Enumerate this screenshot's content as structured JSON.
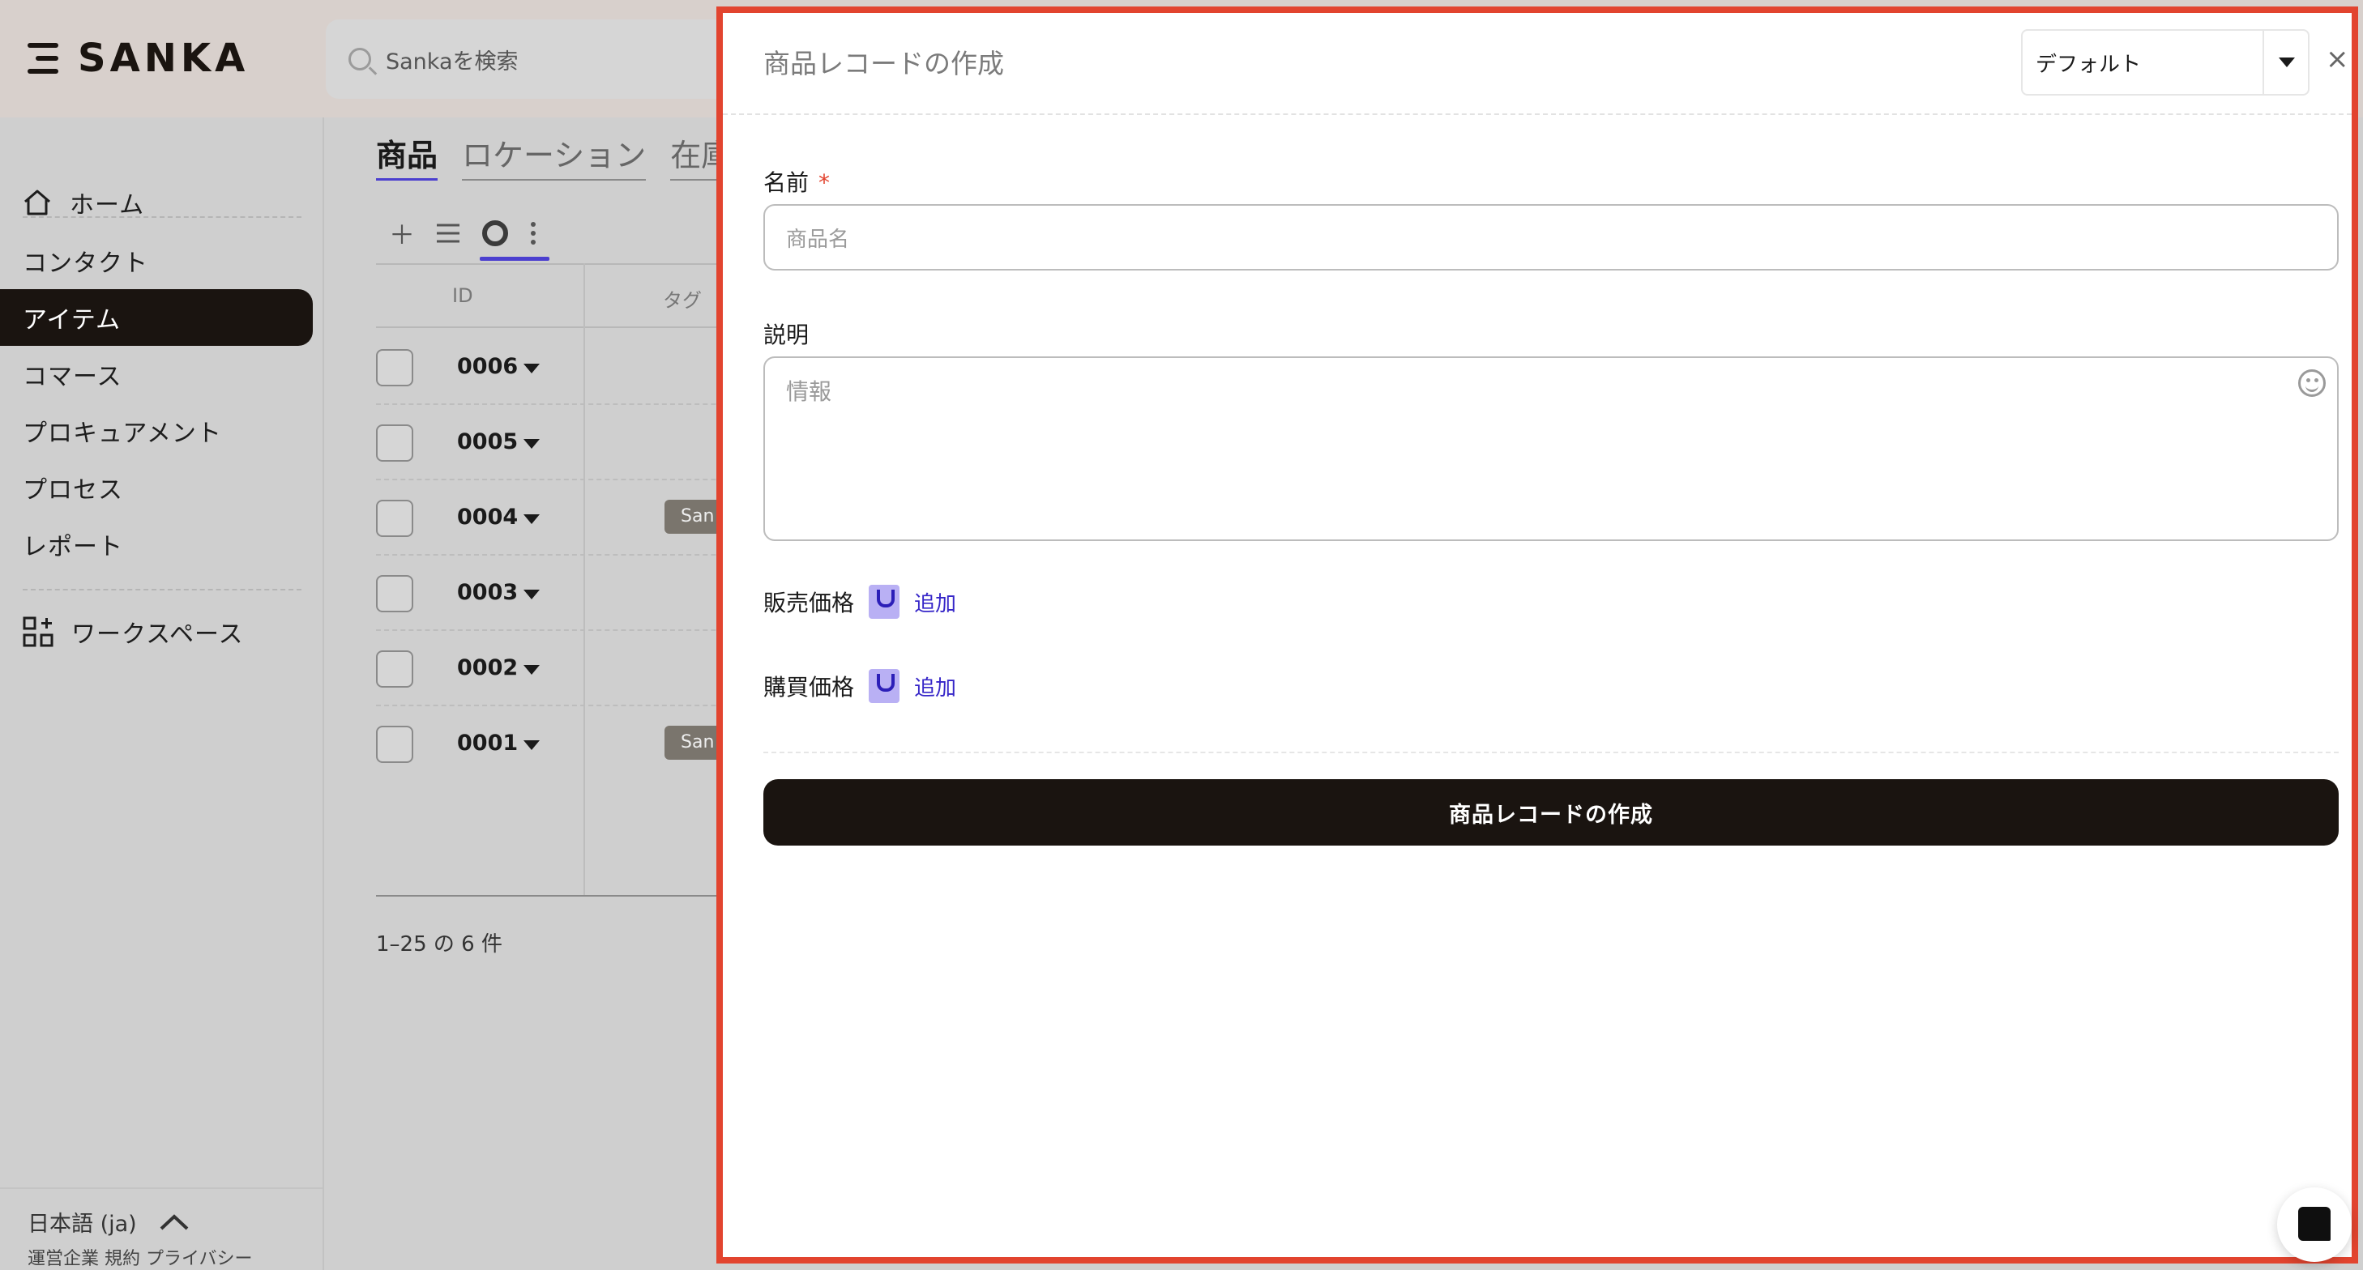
{
  "app": {
    "brand": "SANKA",
    "search_placeholder": "Sankaを検索"
  },
  "sidebar": {
    "items": [
      {
        "label": "ホーム"
      },
      {
        "label": "コンタクト"
      },
      {
        "label": "アイテム",
        "active": true
      },
      {
        "label": "コマース"
      },
      {
        "label": "プロキュアメント"
      },
      {
        "label": "プロセス"
      },
      {
        "label": "レポート"
      },
      {
        "label": "ワークスペース"
      }
    ],
    "language": "日本語 (ja)",
    "footer": "運営企業 規約 プライバシー"
  },
  "main": {
    "tabs": [
      "商品",
      "ロケーション",
      "在庫"
    ],
    "columns": [
      "ID",
      "タグ"
    ],
    "rows": [
      {
        "id": "0006",
        "tag": ""
      },
      {
        "id": "0005",
        "tag": ""
      },
      {
        "id": "0004",
        "tag": "San"
      },
      {
        "id": "0003",
        "tag": ""
      },
      {
        "id": "0002",
        "tag": ""
      },
      {
        "id": "0001",
        "tag": "San"
      }
    ],
    "pagination": "1–25 の 6 件"
  },
  "drawer": {
    "title": "商品レコードの作成",
    "view_select": "デフォルト",
    "close": "×",
    "name_label": "名前",
    "name_required": "*",
    "name_placeholder": "商品名",
    "description_label": "説明",
    "description_placeholder": "情報",
    "sale_price_label": "販売価格",
    "purchase_price_label": "購買価格",
    "add_label": "追加",
    "submit_label": "商品レコードの作成"
  },
  "colors": {
    "accent": "#4b3fcf",
    "drawer_border": "#e2442f",
    "dark": "#1a1410"
  }
}
